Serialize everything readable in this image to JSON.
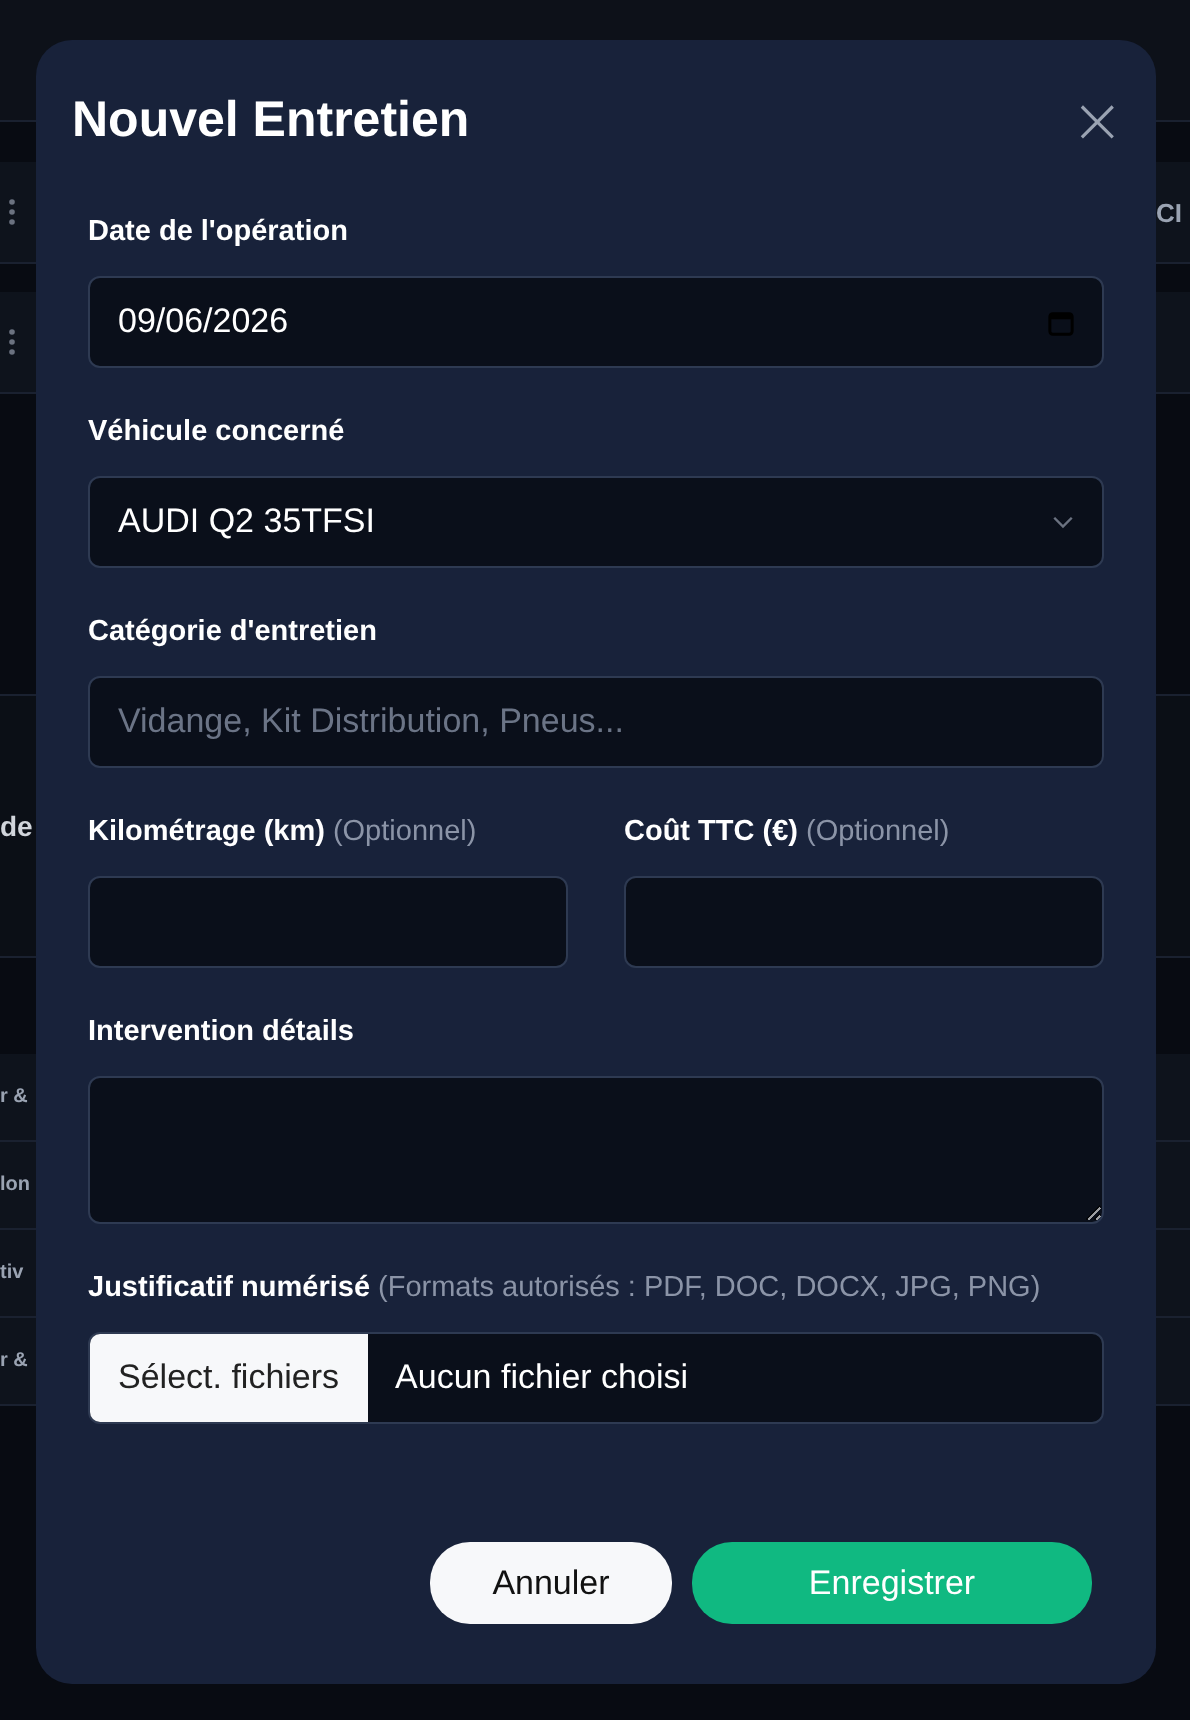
{
  "background": {
    "right_text": "CI",
    "heading_fragment": "de",
    "row_fragments": [
      "r &",
      "lon",
      "tiv",
      "r &"
    ]
  },
  "modal": {
    "title": "Nouvel Entretien",
    "close": "×",
    "fields": [
      {
        "kind": "date",
        "label": "Date de l'opération",
        "value": "09/06/2026"
      },
      {
        "kind": "select",
        "label": "Véhicule concerné",
        "value": "AUDI Q2 35TFSI"
      },
      {
        "kind": "text",
        "label": "Catégorie d'entretien",
        "placeholder": "Vidange, Kit Distribution, Pneus..."
      },
      {
        "kind": "pair",
        "items": [
          {
            "kind": "text",
            "label": "Kilométrage (km)",
            "note": "(Optionnel)"
          },
          {
            "kind": "text",
            "label": "Coût TTC (€)",
            "note": "(Optionnel)"
          }
        ]
      },
      {
        "kind": "textarea",
        "label": "Intervention détails"
      },
      {
        "kind": "file",
        "label": "Justificatif numérisé",
        "note": "(Formats autorisés : PDF, DOC, DOCX, JPG, PNG)",
        "button": "Sélect. fichiers",
        "status": "Aucun fichier choisi"
      }
    ],
    "buttons": [
      {
        "kind": "secondary",
        "label": "Annuler"
      },
      {
        "kind": "primary",
        "label": "Enregistrer"
      }
    ]
  }
}
